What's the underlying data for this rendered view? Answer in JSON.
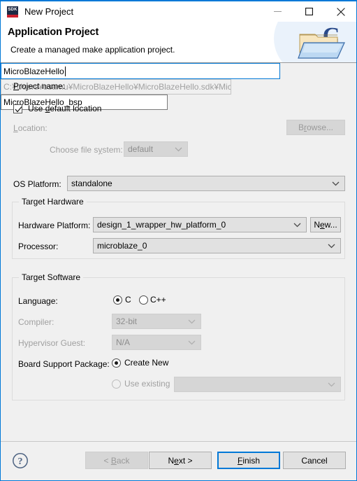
{
  "window": {
    "title": "New Project",
    "app_icon_label": "SDK",
    "controls": {
      "minimize": "minimize-icon",
      "maximize": "maximize-icon",
      "close": "close-icon"
    }
  },
  "banner": {
    "title": "Application Project",
    "subtitle": "Create a managed make application project.",
    "icon": "c-project-folder-icon"
  },
  "form": {
    "project_name": {
      "label_pre": "P",
      "label_post": "roject name:",
      "value": "MicroBlazeHello"
    },
    "use_default_location": {
      "label_pre": "Use ",
      "label_mn": "d",
      "label_post": "efault location",
      "checked": true
    },
    "location": {
      "label_pre": "L",
      "label_post": "ocation:",
      "value": "C:¥Users¥osamu¥MicroBlazeHello¥MicroBlazeHello.sdk¥Micr",
      "browse_pre": "B",
      "browse_mn": "r",
      "browse_post": "owse...",
      "enabled": false
    },
    "file_system": {
      "label_pre": "Choose file s",
      "label_mn": "y",
      "label_post": "stem:",
      "value": "default",
      "enabled": false
    },
    "os_platform": {
      "label": "OS Platform:",
      "value": "standalone"
    }
  },
  "target_hardware": {
    "legend": "Target Hardware",
    "hardware_platform": {
      "label": "Hardware Platform:",
      "value": "design_1_wrapper_hw_platform_0"
    },
    "new_button": {
      "pre": "N",
      "mn": "e",
      "post": "w..."
    },
    "processor": {
      "label": "Processor:",
      "value": "microblaze_0"
    }
  },
  "target_software": {
    "legend": "Target Software",
    "language": {
      "label": "Language:",
      "options": [
        "C",
        "C++"
      ],
      "selected": "C"
    },
    "compiler": {
      "label": "Compiler:",
      "value": "32-bit",
      "enabled": false
    },
    "hypervisor_guest": {
      "label": "Hypervisor Guest:",
      "value": "N/A",
      "enabled": false
    },
    "board_support_package": {
      "label": "Board Support Package:",
      "create_new": {
        "pre": "C",
        "post": "reate New",
        "selected": true,
        "value": "MicroBlazeHello_bsp"
      },
      "use_existing": {
        "pre": "U",
        "post": "se existing",
        "selected": false,
        "value": "",
        "enabled": false
      }
    }
  },
  "footer": {
    "help_icon": "help-icon",
    "buttons": {
      "back": {
        "pre": "< ",
        "mn": "B",
        "post": "ack",
        "enabled": false
      },
      "next": {
        "pre": "N",
        "mn": "e",
        "post": "xt >",
        "enabled": true
      },
      "finish": {
        "pre": "",
        "mn": "F",
        "post": "inish",
        "enabled": true,
        "default": true
      },
      "cancel": {
        "label": "Cancel",
        "enabled": true
      }
    }
  },
  "colors": {
    "accent": "#0078d7",
    "dialog_bg": "#f0f0f0",
    "sdk_red": "#cc1f2d",
    "sdk_navy": "#1d2a44"
  }
}
